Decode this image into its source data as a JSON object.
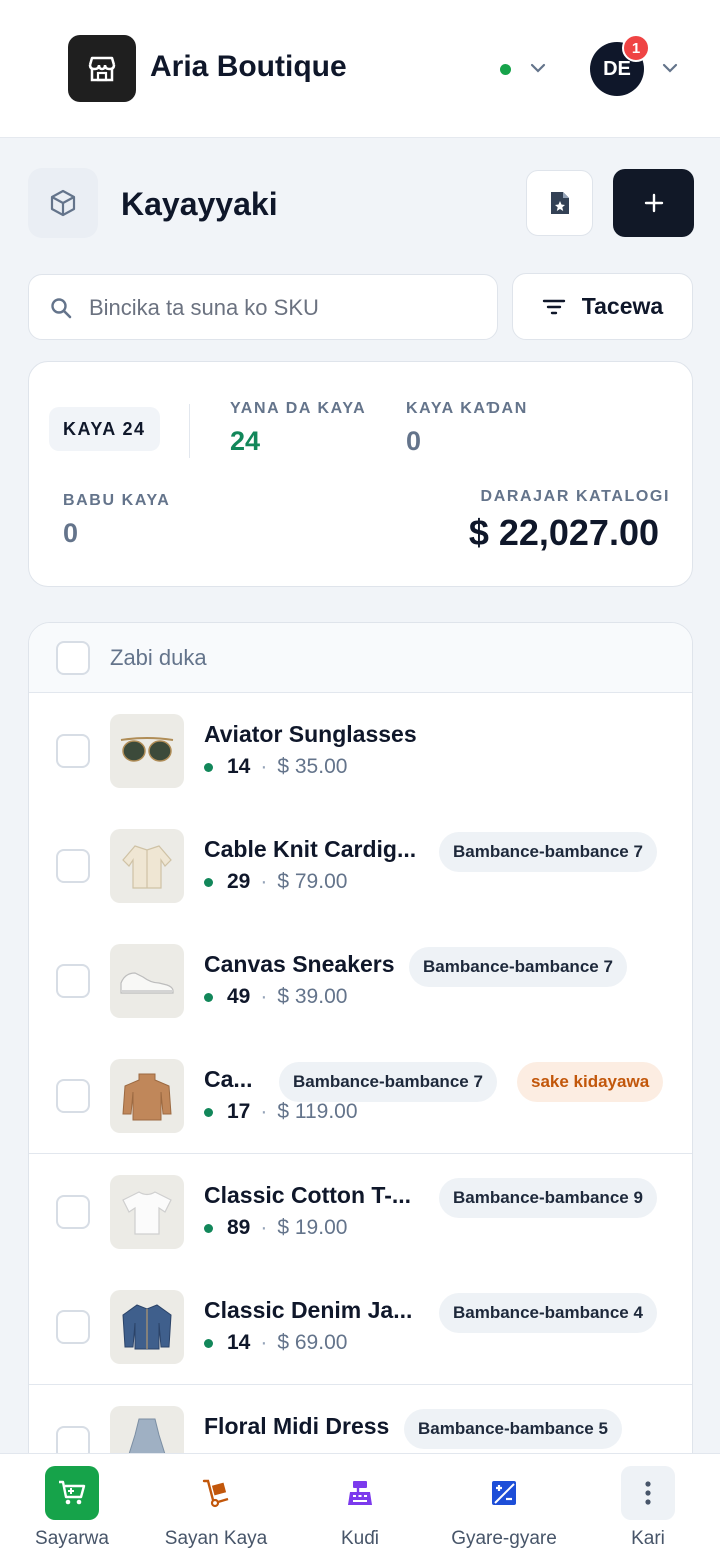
{
  "header": {
    "store_name": "Aria Boutique",
    "user_initials": "DE",
    "notification_count": "1",
    "status_color": "#16a34a"
  },
  "page": {
    "title": "Kayayyaki"
  },
  "search": {
    "placeholder": "Bincika ta suna ko SKU",
    "value": ""
  },
  "filter": {
    "label": "Tacewa"
  },
  "summary": {
    "total_label": "KAYA 24",
    "in_stock_label": "YANA DA KAYA",
    "in_stock_value": "24",
    "low_stock_label": "KAYA KAƊAN",
    "low_stock_value": "0",
    "out_of_stock_label": "BABU KAYA",
    "out_of_stock_value": "0",
    "catalog_value_label": "DARAJAR KATALOGI",
    "catalog_value": "$ 22,027.00"
  },
  "list": {
    "select_all_label": "Zabi duka",
    "items": [
      {
        "name": "Aviator Sunglasses",
        "qty": "14",
        "price": "$ 35.00",
        "variants": "",
        "warn": "",
        "thumb": "sunglasses-icon"
      },
      {
        "name": "Cable Knit Cardig...",
        "qty": "29",
        "price": "$ 79.00",
        "variants": "Bambance-bambance 7",
        "warn": "",
        "thumb": "cardigan-icon"
      },
      {
        "name": "Canvas Sneakers",
        "qty": "49",
        "price": "$ 39.00",
        "variants": "Bambance-bambance 7",
        "warn": "",
        "thumb": "sneakers-icon"
      },
      {
        "name": "Ca...",
        "qty": "17",
        "price": "$ 119.00",
        "variants": "Bambance-bambance 7",
        "warn": "sake kidayawa",
        "thumb": "sweater-icon"
      },
      {
        "name": "Classic Cotton T-...",
        "qty": "89",
        "price": "$ 19.00",
        "variants": "Bambance-bambance 9",
        "warn": "",
        "thumb": "tshirt-icon"
      },
      {
        "name": "Classic Denim Ja...",
        "qty": "14",
        "price": "$ 69.00",
        "variants": "Bambance-bambance 4",
        "warn": "",
        "thumb": "denim-jacket-icon"
      },
      {
        "name": "Floral Midi Dress",
        "qty": "",
        "price": "",
        "variants": "Bambance-bambance 5",
        "warn": "",
        "thumb": "dress-icon"
      }
    ]
  },
  "nav": {
    "items": [
      {
        "label": "Sayarwa",
        "icon": "cart-icon",
        "color": "#16a34a"
      },
      {
        "label": "Sayan Kaya",
        "icon": "dolly-icon",
        "color": "#c2570b"
      },
      {
        "label": "Kuɗi",
        "icon": "cash-register-icon",
        "color": "#7c3aed"
      },
      {
        "label": "Gyare-gyare",
        "icon": "adjust-icon",
        "color": "#1d4ed8"
      },
      {
        "label": "Kari",
        "icon": "more-icon",
        "color": "#475569"
      }
    ]
  }
}
